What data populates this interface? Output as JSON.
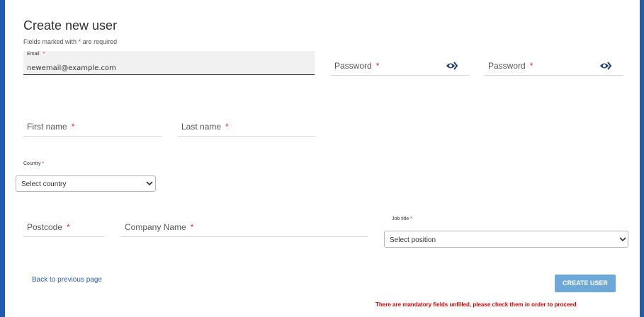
{
  "title": "Create new user",
  "required_note": {
    "prefix": "Fields marked with",
    "star": "*",
    "suffix": "are required"
  },
  "fields": {
    "email": {
      "label": "Email",
      "value": "newemail@example.com"
    },
    "password": {
      "label": "Password"
    },
    "password_confirm": {
      "label": "Password"
    },
    "first_name": {
      "label": "First name"
    },
    "last_name": {
      "label": "Last name"
    },
    "country": {
      "label": "Country",
      "selected": "Select country"
    },
    "postcode": {
      "label": "Postcode"
    },
    "company": {
      "label": "Company Name"
    },
    "job_title": {
      "label": "Job title",
      "selected": "Select position"
    }
  },
  "required_mark": "*",
  "actions": {
    "back_label": "Back to previous page",
    "create_label": "CREATE USER"
  },
  "error_message": "There are mandatory fields unfilled, please check them in order to proceed",
  "colors": {
    "frame": "#1f5db5",
    "required": "#e3262b",
    "button": "#6ea8d8",
    "error": "#e00000",
    "link": "#2d5cb5"
  }
}
